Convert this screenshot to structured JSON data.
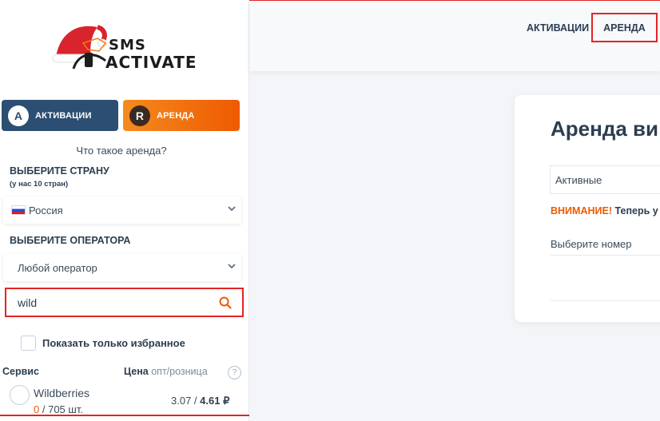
{
  "logo": {
    "sms": "SMS",
    "activate": "ACTIVATE"
  },
  "sidebar": {
    "tab_activations": "АКТИВАЦИИ",
    "tab_rent": "АРЕНДА",
    "what_is_rent": "Что такое аренда?",
    "country_title": "ВЫБЕРИТЕ СТРАНУ",
    "country_sub": "(у нас 10 стран)",
    "country_value": "Россия",
    "operator_title": "ВЫБЕРИТЕ ОПЕРАТОРА",
    "operator_value": "Любой оператор",
    "search_value": "wild",
    "favorites_label": "Показать только избранное",
    "service_header": "Сервис",
    "price_header_bold": "Цена",
    "price_header_rest": "опт/розница",
    "help_mark": "?",
    "services": [
      {
        "name": "Wildberries",
        "available": "0",
        "count_rest": "/ 705 шт.",
        "price_opt": "3.07 /",
        "price_retail": "4.61 ₽"
      }
    ]
  },
  "header": {
    "nav_activations": "АКТИВАЦИИ",
    "nav_rent": "АРЕНДА"
  },
  "main": {
    "title": "Аренда ви",
    "active_dropdown": "Активные",
    "warning_bold": "ВНИМАНИЕ!",
    "warning_rest": "Теперь у",
    "choose_number": "Выберите номер"
  },
  "colors": {
    "accent_orange": "#ee5a00",
    "navy": "#2c4e72",
    "highlight_red": "#e32424"
  }
}
